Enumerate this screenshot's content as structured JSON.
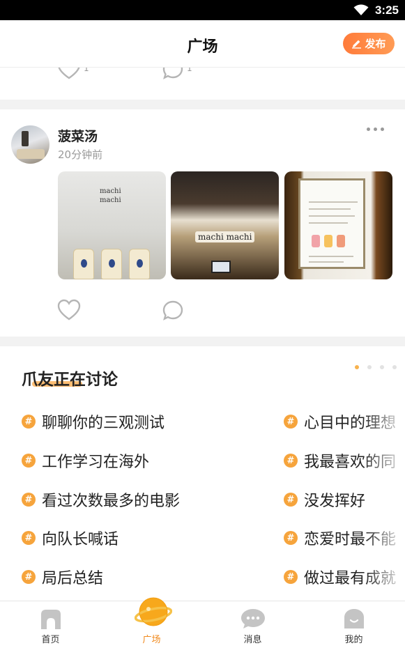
{
  "status_bar": {
    "time": "3:25",
    "wifi_icon": "wifi-icon",
    "battery_icon": "battery-icon"
  },
  "header": {
    "title": "广场",
    "publish_label": "发布",
    "publish_icon": "pencil-icon",
    "accent_color": "#ff8a45"
  },
  "partial_post": {
    "like_count": "1",
    "comment_count": "1"
  },
  "post": {
    "username": "菠菜汤",
    "time": "20分钟前",
    "more_icon": "more-dots-icon",
    "photos": [
      {
        "name": "photo-bottles",
        "sign_text": "machi machi"
      },
      {
        "name": "photo-storefront",
        "sign_text": "machi machi"
      },
      {
        "name": "photo-menu-board"
      }
    ],
    "like_icon": "heart-icon",
    "comment_icon": "comment-icon"
  },
  "discussion": {
    "title": "爪友正在讨论",
    "page_dots": {
      "count": 4,
      "active": 1
    },
    "left_topics": [
      "聊聊你的三观测试",
      "工作学习在海外",
      "看过次数最多的电影",
      "向队长喊话",
      "局后总结"
    ],
    "right_topics": [
      "心目中的理想",
      "我最喜欢的同",
      "没发挥好",
      "恋爱时最不能",
      "做过最有成就"
    ],
    "hash_symbol": "#",
    "hash_color": "#f6a43c"
  },
  "tabbar": {
    "tabs": [
      {
        "label": "首页",
        "icon": "home-icon"
      },
      {
        "label": "广场",
        "icon": "planet-icon",
        "active": true
      },
      {
        "label": "消息",
        "icon": "chat-icon"
      },
      {
        "label": "我的",
        "icon": "profile-icon"
      }
    ],
    "active_color": "#f08a1e"
  }
}
